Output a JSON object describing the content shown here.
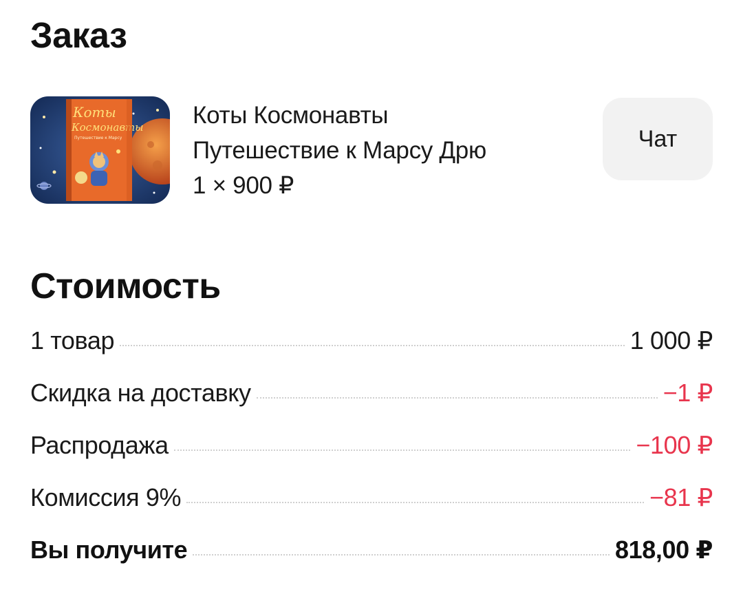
{
  "order": {
    "title": "Заказ",
    "product": {
      "image_icon": "book-cover-image",
      "line1": "Коты Космонавты",
      "line2": "Путешествие к Марсу Дрю",
      "quantity_price": "1 × 900 ₽"
    },
    "chat_label": "Чат"
  },
  "cost": {
    "title": "Стоимость",
    "rows": [
      {
        "label": "1 товар",
        "amount": "1 000 ₽",
        "negative": false
      },
      {
        "label": "Скидка на доставку",
        "amount": "−1 ₽",
        "negative": true
      },
      {
        "label": "Распродажа",
        "amount": "−100 ₽",
        "negative": true
      },
      {
        "label": "Комиссия 9%",
        "amount": "−81 ₽",
        "negative": true
      }
    ],
    "total": {
      "label": "Вы получите",
      "amount": "818,00 ₽"
    }
  },
  "colors": {
    "negative": "#e8354d",
    "chat_button_bg": "#f2f2f2",
    "text": "#1a1a1a"
  }
}
